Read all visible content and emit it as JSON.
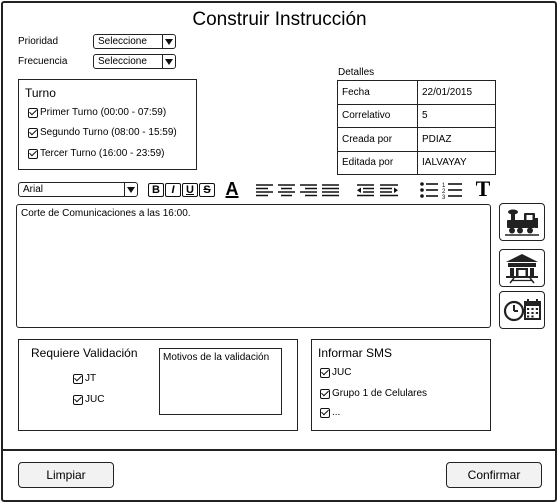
{
  "header": {
    "title": "Construir Instrucción"
  },
  "prioridad": {
    "label": "Prioridad",
    "value": "Seleccione"
  },
  "frecuencia": {
    "label": "Frecuencia",
    "value": "Seleccione"
  },
  "turno": {
    "title": "Turno",
    "options": [
      {
        "label": "Primer Turno (00:00 - 07:59)",
        "checked": true
      },
      {
        "label": "Segundo Turno (08:00 - 15:59)",
        "checked": true
      },
      {
        "label": "Tercer Turno (16:00 - 23:59)",
        "checked": true
      }
    ]
  },
  "detalles": {
    "title": "Detalles",
    "rows": [
      {
        "key": "Fecha",
        "value": "22/01/2015"
      },
      {
        "key": "Correlativo",
        "value": "5"
      },
      {
        "key": "Creada por",
        "value": "PDIAZ"
      },
      {
        "key": "Editada por",
        "value": "IALVAYAY"
      }
    ]
  },
  "toolbar": {
    "font": "Arial",
    "bold": "B",
    "italic": "I",
    "underline": "U",
    "strike": "S",
    "color": "A",
    "text_size": "T"
  },
  "editor": {
    "content": "Corte de Comunicaciones a las 16:00."
  },
  "side_buttons": [
    "train-icon",
    "station-icon",
    "schedule-icon"
  ],
  "validacion": {
    "title": "Requiere Validación",
    "options": [
      {
        "label": "JT",
        "checked": true
      },
      {
        "label": "JUC",
        "checked": true
      }
    ],
    "motivos_label": "Motivos de la validación"
  },
  "sms": {
    "title": "Informar SMS",
    "options": [
      {
        "label": "JUC",
        "checked": true
      },
      {
        "label": "Grupo 1 de Celulares",
        "checked": true
      },
      {
        "label": "...",
        "checked": true
      }
    ]
  },
  "footer": {
    "clear_label": "Limpiar",
    "confirm_label": "Confirmar"
  }
}
